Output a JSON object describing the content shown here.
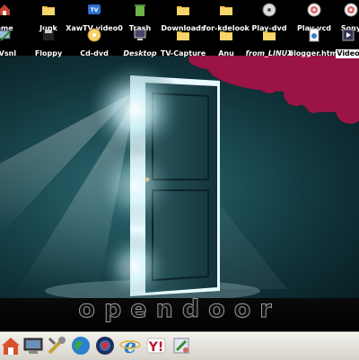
{
  "desktop": {
    "icons_row1": [
      {
        "label": "ome",
        "icon": "home-folder-icon"
      },
      {
        "label": "Junk",
        "icon": "folder-icon"
      },
      {
        "label": "XawTV video0",
        "icon": "tv-icon"
      },
      {
        "label": "Trash",
        "icon": "trash-icon"
      },
      {
        "label": "Downloads",
        "icon": "folder-icon"
      },
      {
        "label": "for-kdelook",
        "icon": "folder-icon"
      },
      {
        "label": "Play-dvd",
        "icon": "dvd-icon"
      },
      {
        "label": "Play-vcd",
        "icon": "cd-icon"
      },
      {
        "label": "Sony",
        "icon": "cd-icon"
      }
    ],
    "icons_row2": [
      {
        "label": "t/Vsnl",
        "icon": "network-icon"
      },
      {
        "label": "Floppy",
        "icon": "floppy-icon"
      },
      {
        "label": "Cd-dvd",
        "icon": "cdrom-icon"
      },
      {
        "label": "Desktop",
        "icon": "desktop-icon"
      },
      {
        "label": "TV-Capture",
        "icon": "folder-icon"
      },
      {
        "label": "Anu",
        "icon": "folder-icon"
      },
      {
        "label": "from_LINUX",
        "icon": "folder-icon"
      },
      {
        "label": "blogger.html",
        "icon": "html-file-icon"
      },
      {
        "label": "Video",
        "icon": "video-file-icon"
      }
    ],
    "wallpaper_text": "opendoor"
  },
  "taskbar": {
    "launchers": [
      "home-icon",
      "computer-icon",
      "tools-icon",
      "globe-icon",
      "mozilla-icon",
      "internet-explorer-icon",
      "yahoo-icon",
      "settings-icon"
    ]
  },
  "colors": {
    "accent": "#9b1446",
    "wall": "#1b4a52"
  }
}
